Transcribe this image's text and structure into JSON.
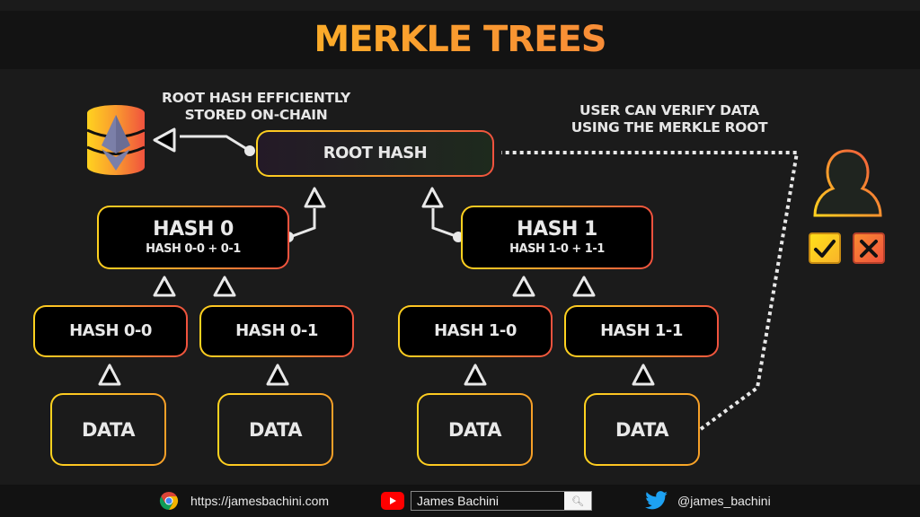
{
  "title": "MERKLE TREES",
  "captions": {
    "storage": [
      "ROOT HASH EFFICIENTLY",
      "STORED ON-CHAIN"
    ],
    "verify": [
      "USER CAN VERIFY DATA",
      "USING THE MERKLE ROOT"
    ]
  },
  "tree": {
    "root": {
      "label": "ROOT HASH"
    },
    "level1": [
      {
        "label": "HASH 0",
        "sub": "HASH 0-0 + 0-1"
      },
      {
        "label": "HASH 1",
        "sub": "HASH 1-0 + 1-1"
      }
    ],
    "level2": [
      {
        "label": "HASH 0-0"
      },
      {
        "label": "HASH 0-1"
      },
      {
        "label": "HASH 1-0"
      },
      {
        "label": "HASH 1-1"
      }
    ],
    "leaves": [
      {
        "label": "DATA"
      },
      {
        "label": "DATA"
      },
      {
        "label": "DATA"
      },
      {
        "label": "DATA"
      }
    ]
  },
  "icons": {
    "database": "ethereum-database-icon",
    "user": "user-icon",
    "valid": "check-icon",
    "invalid": "x-icon"
  },
  "colors": {
    "gradient_start": "#ffd21f",
    "gradient_mid": "#f99a2f",
    "gradient_end": "#f0523e",
    "background": "#1b1b1b",
    "text": "#e8e8e8"
  },
  "footer": {
    "website": "https://jamesbachini.com",
    "youtube": "James Bachini",
    "twitter": "@james_bachini"
  }
}
